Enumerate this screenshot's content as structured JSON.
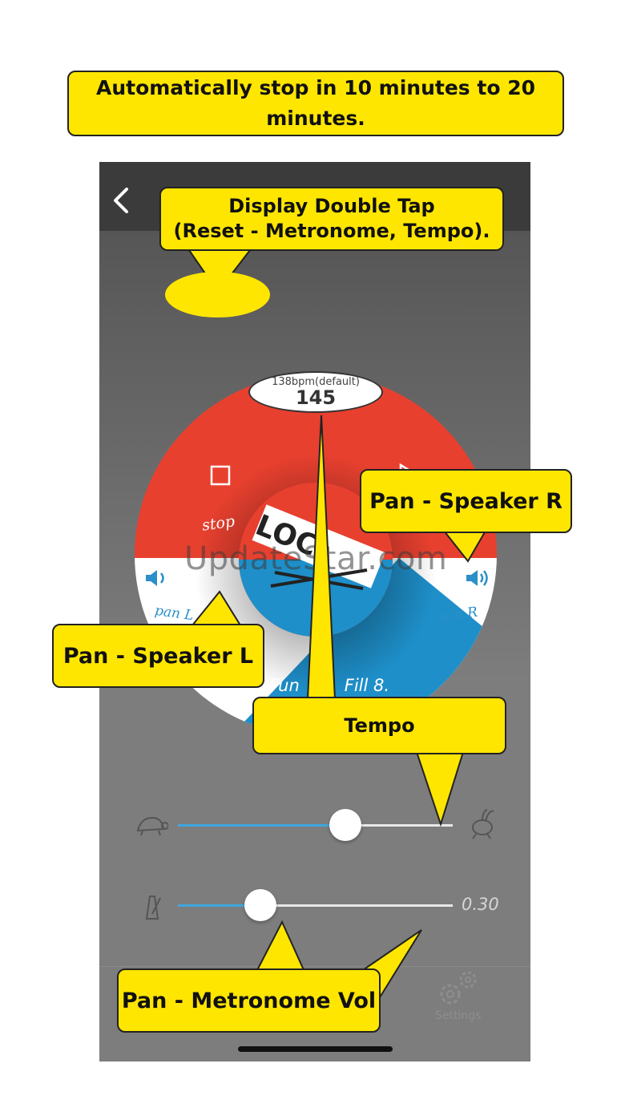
{
  "callouts": {
    "auto_stop": "Automatically stop in 10 minutes to 20 minutes.",
    "display_double_tap": "Display Double Tap\n(Reset - Metronome, Tempo).",
    "pan_speaker_r": "Pan - Speaker R",
    "pan_speaker_l": "Pan - Speaker L",
    "tempo": "Tempo",
    "pan_metronome_vol": "Pan - Metronome Vol"
  },
  "bpm": {
    "default_label": "138bpm(default)",
    "value": "145"
  },
  "dial": {
    "stop_label": "stop",
    "pan_l_label": "pan L",
    "pan_r_label": "pan R",
    "logo_text": "LOC",
    "fill_label": "(D). Fun",
    "fill_label_end": "Fill 8."
  },
  "sliders": {
    "tempo_level": 0.61,
    "volume_level": 0.3,
    "volume_value": "0.30"
  },
  "tabbar": {
    "settings_label": "Settings"
  },
  "watermark": "UpdateStar.com",
  "colors": {
    "callout": "#ffe600",
    "dial_red": "#e8402f",
    "dial_blue": "#1e8fc9",
    "track_blue": "#3ea6de"
  },
  "icons": [
    "back-chevron-icon",
    "stop-square-icon",
    "play-icon",
    "speaker-left-icon",
    "speaker-right-icon",
    "turtle-icon",
    "rabbit-icon",
    "metronome-icon",
    "gear-icon"
  ]
}
